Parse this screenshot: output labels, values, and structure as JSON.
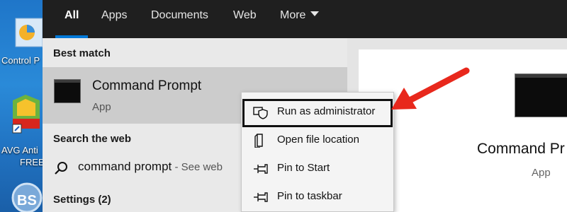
{
  "desktop": {
    "icons": [
      {
        "name": "control-panel",
        "label": "Control P"
      },
      {
        "name": "avg-antivirus",
        "label": "AVG Anti"
      },
      {
        "name": "avg-antivirus-line2",
        "label": "FREE"
      },
      {
        "name": "bluestacks",
        "label": ""
      }
    ]
  },
  "tabs": [
    {
      "label": "All",
      "active": true
    },
    {
      "label": "Apps"
    },
    {
      "label": "Documents"
    },
    {
      "label": "Web"
    },
    {
      "label": "More"
    }
  ],
  "results": {
    "best_match_heading": "Best match",
    "best_match": {
      "title": "Command Prompt",
      "subtitle": "App"
    },
    "search_web_heading": "Search the web",
    "web_query": "command prompt",
    "web_suffix": " - See web",
    "settings_heading": "Settings (2)"
  },
  "context_menu": {
    "items": [
      {
        "label": "Run as administrator",
        "icon": "shield-icon",
        "highlighted": true
      },
      {
        "label": "Open file location",
        "icon": "file-location-icon"
      },
      {
        "label": "Pin to Start",
        "icon": "pin-icon"
      },
      {
        "label": "Pin to taskbar",
        "icon": "pin-icon"
      }
    ]
  },
  "preview": {
    "title": "Command Pr",
    "subtitle": "App"
  },
  "colors": {
    "accent": "#0078d7",
    "annotation_arrow": "#e8281c",
    "topbar": "#1f1f1f"
  }
}
